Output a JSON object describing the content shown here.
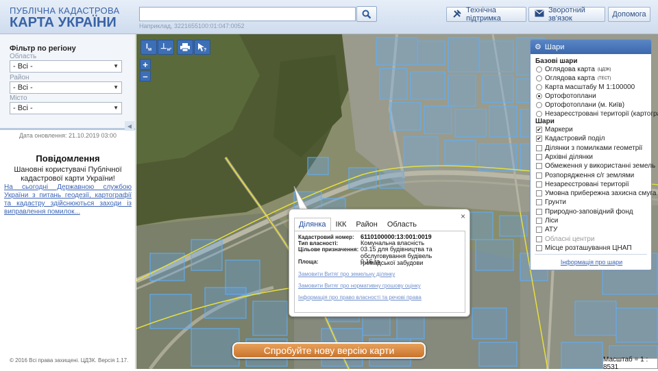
{
  "header": {
    "logo_line1": "ПУБЛІЧНА КАДАСТРОВА",
    "logo_line2": "КАРТА УКРАЇНИ",
    "search_value": "",
    "search_hint": "Наприклад, 3221655100:01:047:0052",
    "buttons": {
      "support": "Технічна підтримка",
      "feedback": "Зворотний зв'язок",
      "help": "Допомога"
    }
  },
  "sidebar": {
    "filter_title": "Фільтр по регіону",
    "filters": [
      {
        "label": "Область",
        "value": "- Всі -"
      },
      {
        "label": "Район",
        "value": "- Всі -"
      },
      {
        "label": "Місто",
        "value": "- Всі -"
      }
    ],
    "update_date": "Дата оновлення: 21.10.2019 03:00",
    "news_title": "Повідомлення",
    "news_body": "Шановні користувачі Публічної кадастрової карти України!",
    "news_link": "На сьогодні Державною службою України з питань геодезії, картографії та кадастру здійснюються заходи із виправлення помилок...",
    "footer": "© 2016 Всі права захищені. ЦДЗК. Версія 1.17."
  },
  "map": {
    "tools": [
      "I м",
      "⊥м²",
      "print",
      "cursor-help"
    ],
    "tools_text": {
      "measure_length": "I",
      "measure_length_sub": "м",
      "measure_area": "⊥",
      "measure_area_sub": "м²"
    },
    "zoom_in": "+",
    "zoom_out": "–",
    "try_new": "Спробуйте нову версію карти",
    "scale": "Масштаб = 1 : 8531"
  },
  "layers": {
    "title": "Шари",
    "base_title": "Базові шари",
    "base": [
      {
        "label": "Оглядова карта",
        "sup": "(ЦДЗК)",
        "selected": false
      },
      {
        "label": "Оглядова карта",
        "sup": "(ТЕСТ)",
        "selected": false
      },
      {
        "label": "Карта масштабу М 1:100000",
        "sup": "",
        "selected": false
      },
      {
        "label": "Ортофотоплани",
        "sup": "",
        "selected": true
      },
      {
        "label": "Ортофотоплани (м. Київ)",
        "sup": "",
        "selected": false
      },
      {
        "label": "Незареєстровані території (картограма)",
        "sup": "",
        "selected": false
      }
    ],
    "layers_title": "Шари",
    "items": [
      {
        "label": "Маркери",
        "checked": true,
        "disabled": false
      },
      {
        "label": "Кадастровий поділ",
        "checked": true,
        "disabled": false
      },
      {
        "label": "Ділянки з помилками геометрії",
        "checked": false,
        "disabled": false
      },
      {
        "label": "Архівні ділянки",
        "checked": false,
        "disabled": false
      },
      {
        "label": "Обмеження у використанні земель",
        "checked": false,
        "disabled": false
      },
      {
        "label": "Розпорядження с/г землями",
        "checked": false,
        "disabled": false
      },
      {
        "label": "Незареєстровані території",
        "checked": false,
        "disabled": false
      },
      {
        "label": "Умовна прибережна захисна смуга",
        "checked": false,
        "disabled": false
      },
      {
        "label": "Грунти",
        "checked": false,
        "disabled": false
      },
      {
        "label": "Природно-заповідний фонд",
        "checked": false,
        "disabled": false
      },
      {
        "label": "Ліси",
        "checked": false,
        "disabled": false
      },
      {
        "label": "АТУ",
        "checked": false,
        "disabled": false
      },
      {
        "label": "Обласні центри",
        "checked": false,
        "disabled": true
      },
      {
        "label": "Місце розташування ЦНАП",
        "checked": false,
        "disabled": false
      }
    ],
    "info_link": "Інформація про шари"
  },
  "popup": {
    "close": "×",
    "tabs": [
      "Ділянка",
      "ІКК",
      "Район",
      "Область"
    ],
    "active_tab": 0,
    "fields": [
      {
        "label": "Кадастровий номер:",
        "value": "6110100000:13:001:0019"
      },
      {
        "label": "Тип власності:",
        "value": "Комунальна власність"
      },
      {
        "label": "Цільове призначення:",
        "value": "03.15 для будівництва та обслуговування будівель громадської забудови"
      },
      {
        "label": "Площа:",
        "value": "0.16 га"
      }
    ],
    "links": [
      "Замовити Витяг про земельну ділянку",
      "Замовити Витяг про нормативну грошову оцінку",
      "Інформація про право власності та речові права"
    ]
  },
  "colors": {
    "accent": "#3d6fb7",
    "parcel_outline": "#5ab0ff",
    "try_button": "#d98a3f"
  }
}
